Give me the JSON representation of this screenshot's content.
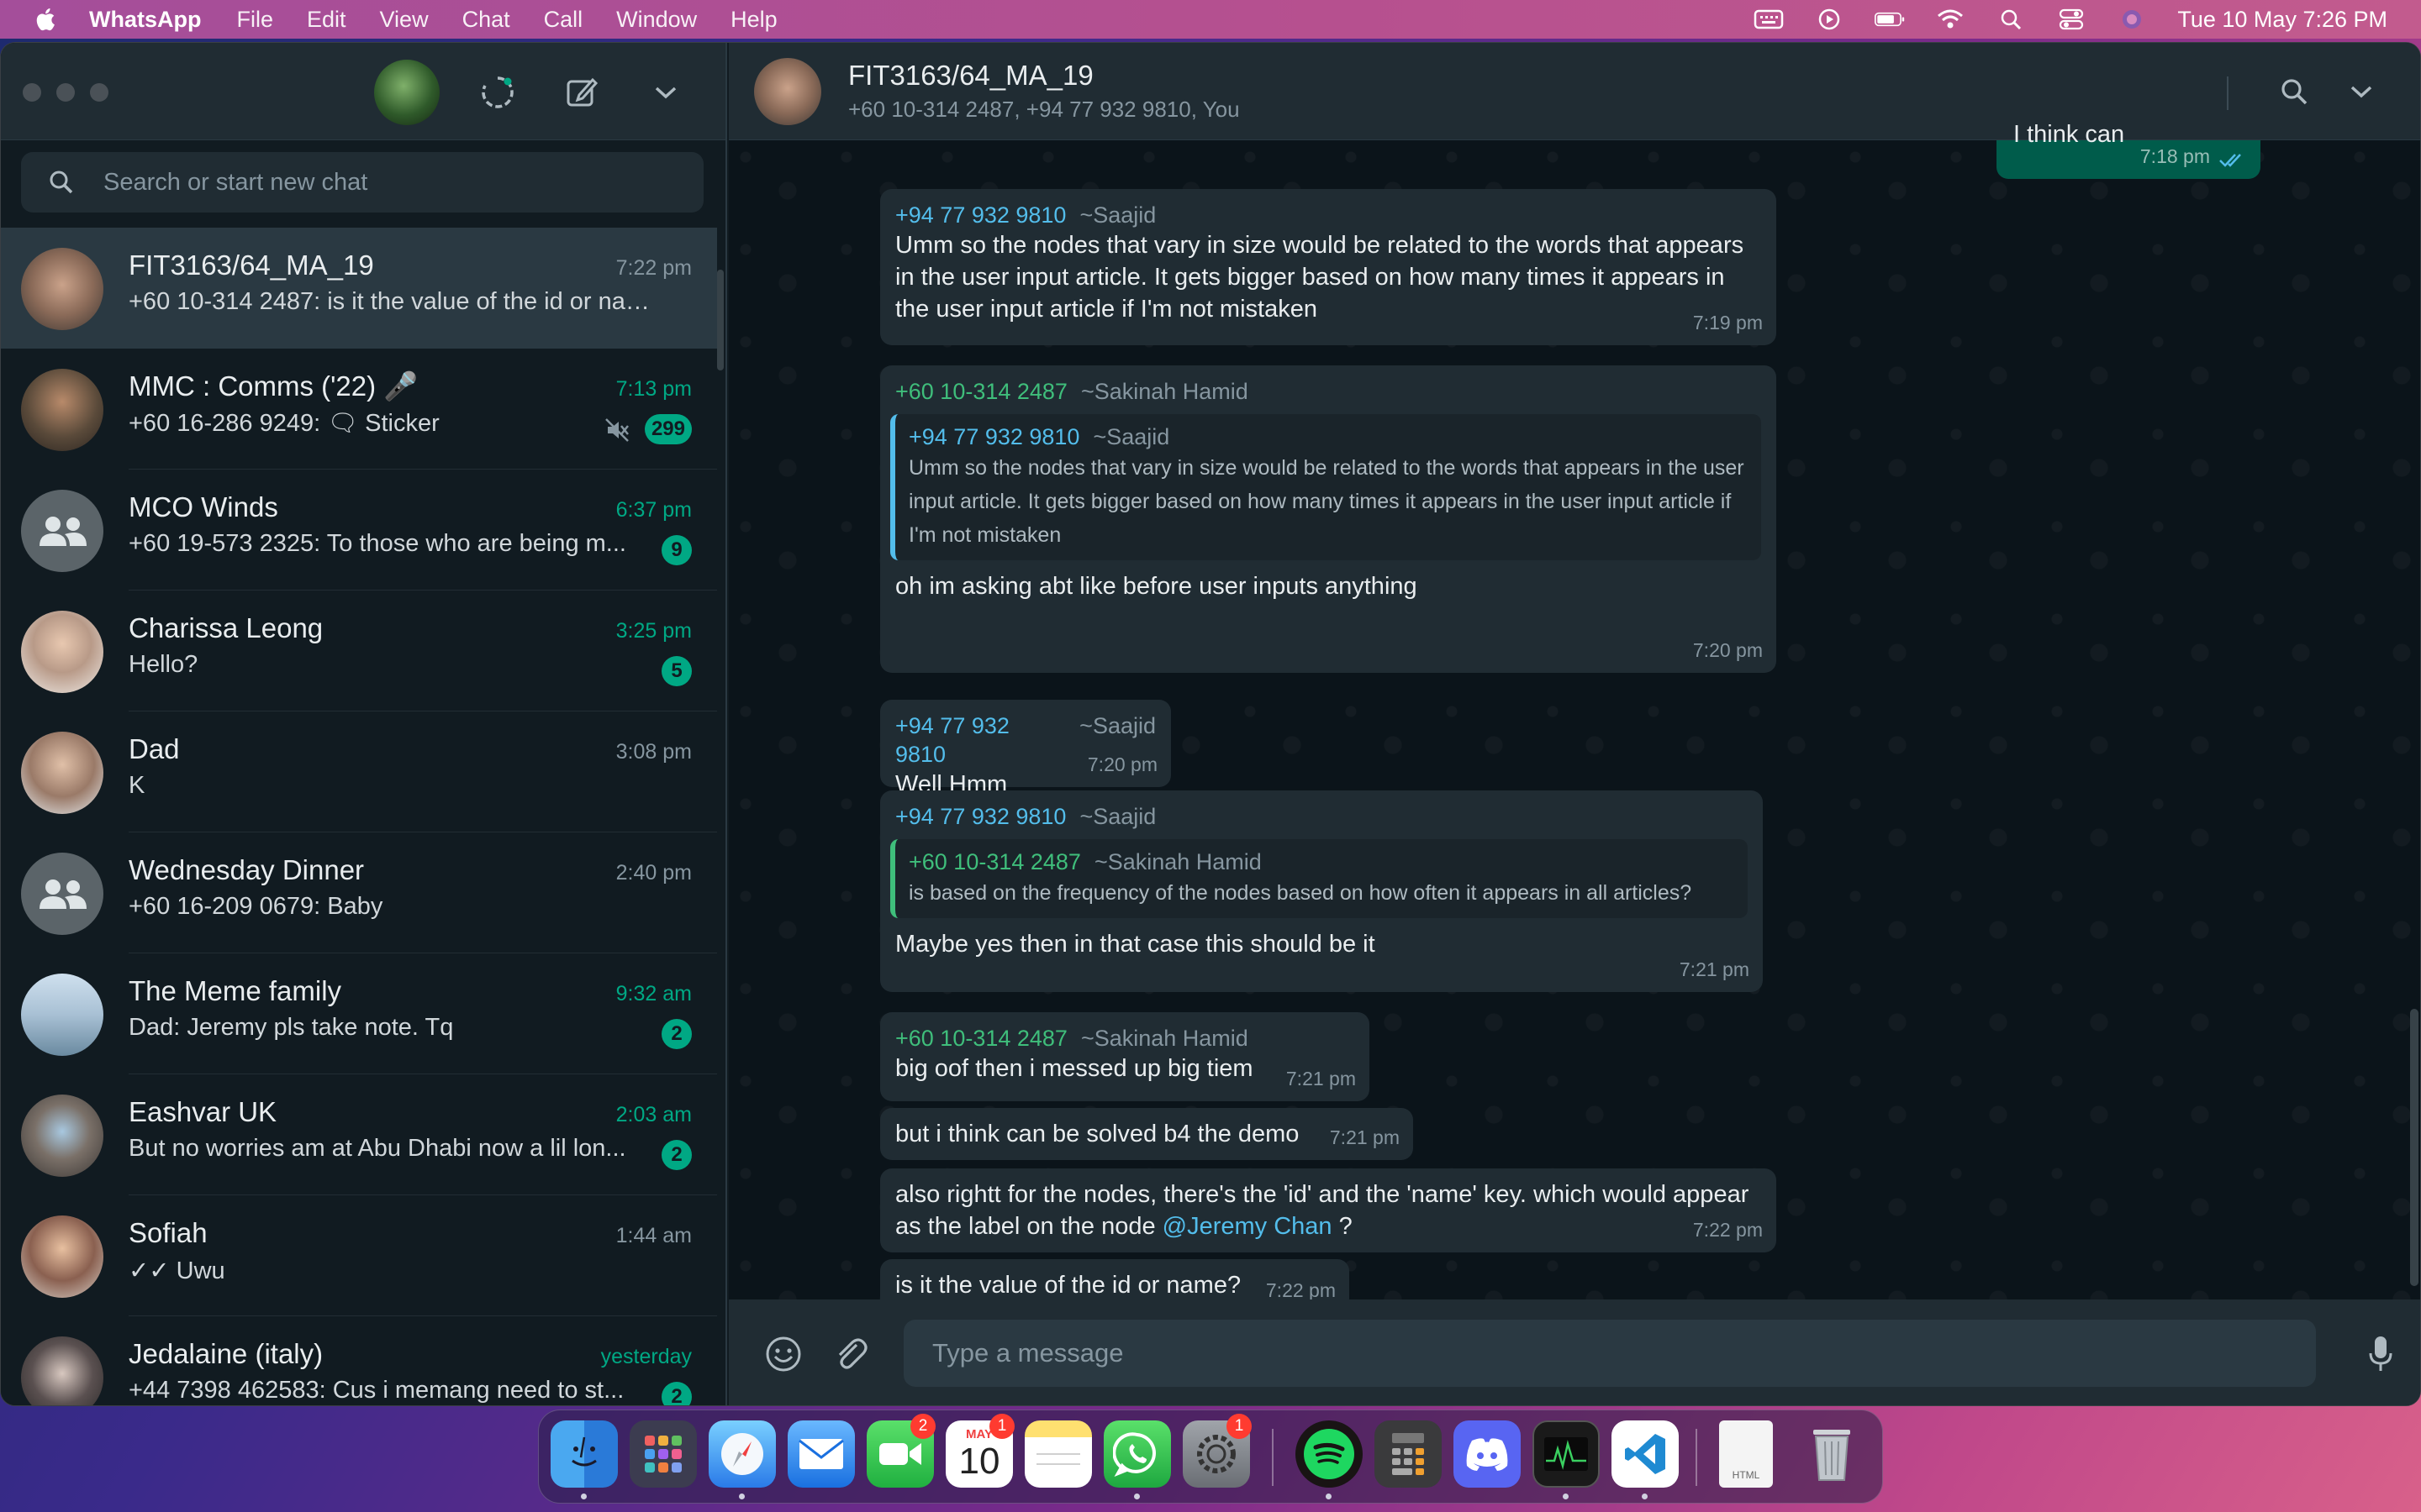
{
  "menubar": {
    "app_name": "WhatsApp",
    "menus": [
      "File",
      "Edit",
      "View",
      "Chat",
      "Call",
      "Window",
      "Help"
    ],
    "clock": "Tue 10 May  7:26 PM"
  },
  "sidebar": {
    "search_placeholder": "Search or start new chat",
    "chats": [
      {
        "name": "FIT3163/64_MA_19",
        "time": "7:22 pm",
        "preview": "+60 10-314 2487: is it the value of the id or name?",
        "badge": "",
        "time_unread": false
      },
      {
        "name": "MMC : Comms ('22) 🎤",
        "time": "7:13 pm",
        "preview": "+60 16-286 9249: 🗨 Sticker",
        "badge": "299",
        "time_unread": true,
        "muted": true
      },
      {
        "name": "MCO Winds",
        "time": "6:37 pm",
        "preview": "+60 19-573 2325: To those who are being m...",
        "badge": "9",
        "time_unread": true
      },
      {
        "name": "Charissa Leong",
        "time": "3:25 pm",
        "preview": "Hello?",
        "badge": "5",
        "time_unread": true
      },
      {
        "name": "Dad",
        "time": "3:08 pm",
        "preview": "K",
        "badge": "",
        "time_unread": false
      },
      {
        "name": "Wednesday Dinner",
        "time": "2:40 pm",
        "preview": "+60 16-209 0679: Baby",
        "badge": "",
        "time_unread": false
      },
      {
        "name": "The Meme family",
        "time": "9:32 am",
        "preview": "Dad: Jeremy pls take note. Tq",
        "badge": "2",
        "time_unread": true
      },
      {
        "name": "Eashvar UK",
        "time": "2:03 am",
        "preview": "But no worries am at Abu Dhabi now a lil lon...",
        "badge": "2",
        "time_unread": true
      },
      {
        "name": "Sofiah",
        "time": "1:44 am",
        "preview": "✓✓ Uwu",
        "badge": "",
        "time_unread": false
      },
      {
        "name": "Jedalaine (italy)",
        "time": "yesterday",
        "preview": "+44 7398 462583: Cus i memang need to st...",
        "badge": "2",
        "time_unread": true
      }
    ]
  },
  "conversation": {
    "title": "FIT3163/64_MA_19",
    "members": "+60 10-314 2487, +94 77 932 9810, You",
    "compose_placeholder": "Type a message",
    "messages": {
      "m0": {
        "text": "I think can",
        "time": "7:18 pm"
      },
      "m1": {
        "phone": "+94 77 932 9810",
        "alias": "~Saajid",
        "text": "Umm so the nodes that vary in size would be related to the words that appears in the user input article. It gets bigger based on how many times it appears in the user input article if I'm not mistaken",
        "time": "7:19 pm"
      },
      "m2": {
        "phone": "+60 10-314 2487",
        "alias": "~Sakinah Hamid",
        "quote_phone": "+94 77 932 9810",
        "quote_alias": "~Saajid",
        "quote_text": "Umm so the nodes that vary in size would be related to the words that appears in the user input article. It gets bigger based on how many times it appears in the user input article if I'm not mistaken",
        "text": "oh im asking abt like before user inputs anything",
        "time": "7:20 pm"
      },
      "m3": {
        "phone": "+94 77 932 9810",
        "alias": "~Saajid",
        "text": "Well Hmm",
        "time": "7:20 pm"
      },
      "m4": {
        "phone": "+94 77 932 9810",
        "alias": "~Saajid",
        "quote_phone": "+60 10-314 2487",
        "quote_alias": "~Sakinah Hamid",
        "quote_text": "is based on the frequency of the nodes based on how often it appears in all articles?",
        "text": "Maybe yes then in that case this should be it",
        "time": "7:21 pm"
      },
      "m5": {
        "phone": "+60 10-314 2487",
        "alias": "~Sakinah Hamid",
        "text": "big oof then i messed up big tiem",
        "time": "7:21 pm"
      },
      "m6": {
        "text": "but i think can be solved b4 the demo",
        "time": "7:21 pm"
      },
      "m7": {
        "text_before": "also rightt for the nodes, there's the 'id' and the 'name' key. which would appear as the label on the node ",
        "mention": "@Jeremy Chan",
        "text_after": " ?",
        "time": "7:22 pm"
      },
      "m8": {
        "text": "is it the value of the id or name?",
        "time": "7:22 pm"
      }
    }
  },
  "dock": {
    "badges": {
      "facetime": "2",
      "calendar": "1",
      "settings": "1"
    },
    "calendar_month": "MAY",
    "calendar_day": "10",
    "file_label": "HTML"
  },
  "colors": {
    "accent": "#00a884",
    "link": "#53bdeb",
    "bubble_in": "#202c33",
    "bubble_out": "#005c4b"
  }
}
